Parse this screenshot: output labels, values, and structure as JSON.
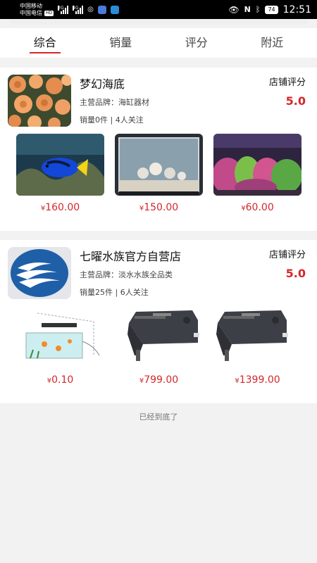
{
  "status_bar": {
    "carrier1": "中国移动",
    "carrier2": "中国电信",
    "hd_badge": "HD",
    "sig1_label": "2G",
    "sig2_label": "4G",
    "battery": "74",
    "time": "12:51"
  },
  "tabs": [
    {
      "label": "综合",
      "active": true
    },
    {
      "label": "销量",
      "active": false
    },
    {
      "label": "评分",
      "active": false
    },
    {
      "label": "附近",
      "active": false
    }
  ],
  "shops": [
    {
      "name": "梦幻海底",
      "brand": "主营品牌：海缸器材",
      "stats": "销量0件 | 4人关注",
      "rating_label": "店铺评分",
      "rating": "5.0",
      "products": [
        {
          "price": "160.00",
          "currency": "¥",
          "image": "blue-tang-fish-image"
        },
        {
          "price": "150.00",
          "currency": "¥",
          "image": "reef-tank-image"
        },
        {
          "price": "60.00",
          "currency": "¥",
          "image": "planted-tank-image"
        }
      ]
    },
    {
      "name": "七曜水族官方自营店",
      "brand": "主营品牌：淡水水族全品类",
      "stats": "销量25件 | 6人关注",
      "rating_label": "店铺评分",
      "rating": "5.0",
      "products": [
        {
          "price": "0.10",
          "currency": "¥",
          "image": "aquarium-light-sketch-image"
        },
        {
          "price": "799.00",
          "currency": "¥",
          "image": "aquarium-led-light-image"
        },
        {
          "price": "1399.00",
          "currency": "¥",
          "image": "aquarium-led-light-image"
        }
      ]
    }
  ],
  "footer": {
    "end_text": "已经到底了"
  },
  "colors": {
    "accent": "#d4262b",
    "background": "#f2f2f2"
  }
}
